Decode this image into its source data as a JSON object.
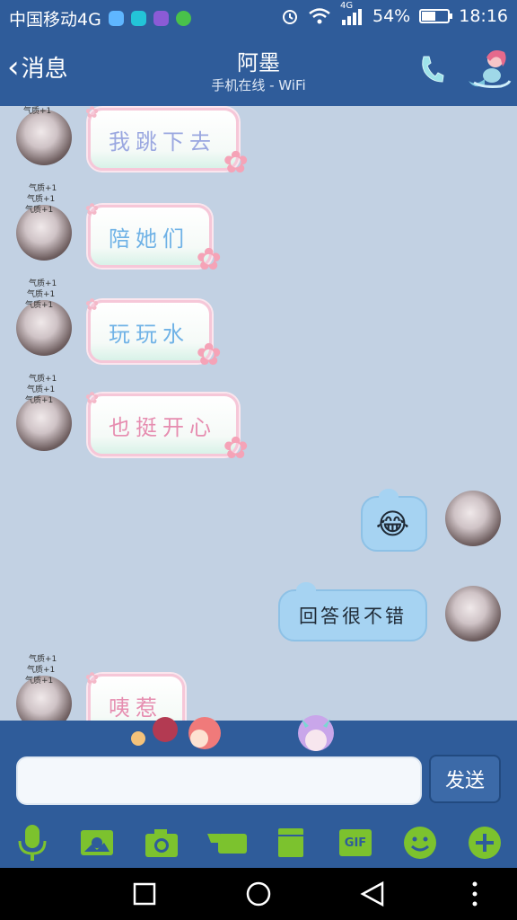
{
  "status_bar": {
    "carrier": "中国移动4G",
    "network_small": "4G",
    "battery": "54%",
    "battery_level": 0.54,
    "time": "18:16"
  },
  "header": {
    "back_label": "消息",
    "title": "阿墨",
    "subtitle": "手机在线 - WiFi"
  },
  "messages": [
    {
      "from": "other",
      "text": "我跳下去",
      "tags": [
        "气质+1"
      ]
    },
    {
      "from": "other",
      "text": "陪她们",
      "tags": [
        "气质+1",
        "气质+1",
        "气质+1"
      ]
    },
    {
      "from": "other",
      "text": "玩玩水",
      "tags": [
        "气质+1",
        "气质+1",
        "气质+1"
      ]
    },
    {
      "from": "other",
      "text": "也挺开心",
      "tags": [
        "气质+1",
        "气质+1",
        "气质+1"
      ]
    },
    {
      "from": "me",
      "text": "😂"
    },
    {
      "from": "me",
      "text": "回答很不错"
    },
    {
      "from": "other",
      "text": "咦惹",
      "tags": [
        "气质+1",
        "气质+1",
        "气质+1"
      ]
    }
  ],
  "input": {
    "placeholder": "",
    "value": "",
    "send_label": "发送"
  },
  "toolbar": {
    "gif_label": "GIF",
    "icons": [
      "microphone-icon",
      "picture-icon",
      "camera-icon",
      "red-packet-icon",
      "file-icon",
      "gif-icon",
      "emoji-icon",
      "plus-icon"
    ]
  },
  "colors": {
    "bar_blue": "#2f5c9a",
    "chat_bg": "#c2d1e3",
    "tool_green": "#7cc22e",
    "bubble_out": "#a6d3f2"
  }
}
